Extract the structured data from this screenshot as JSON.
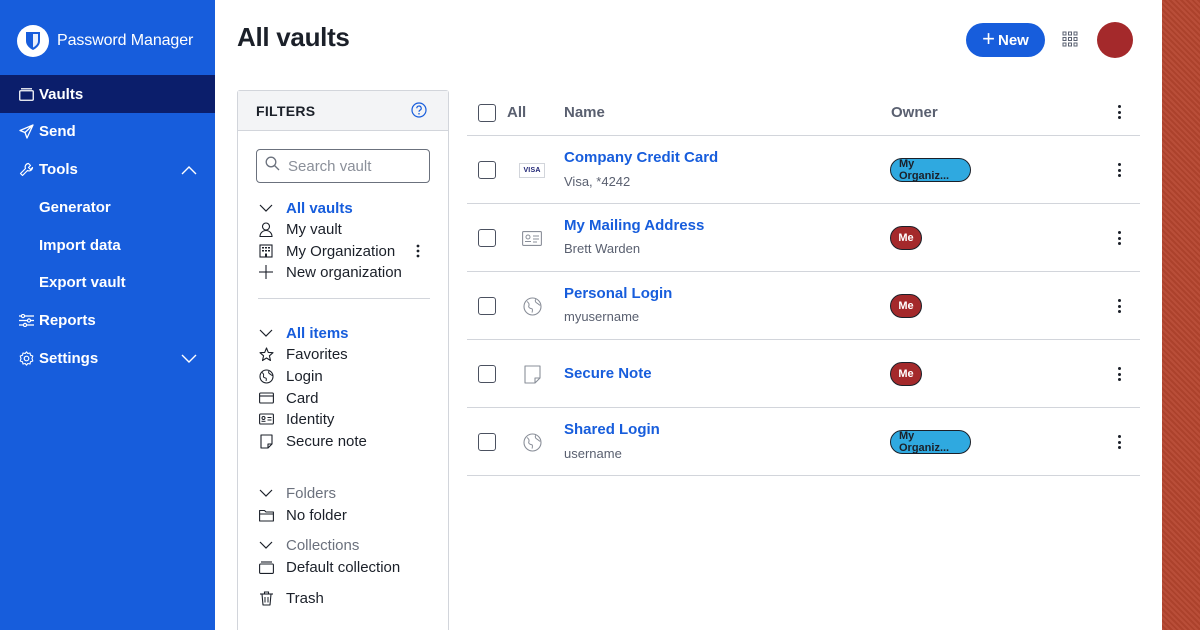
{
  "brand": {
    "name": "Password Manager"
  },
  "sidebar": {
    "items": [
      {
        "label": "Vaults",
        "icon": "vault-icon",
        "active": true
      },
      {
        "label": "Send",
        "icon": "send-icon"
      },
      {
        "label": "Tools",
        "icon": "tools-icon",
        "expanded": true
      },
      {
        "label": "Generator",
        "sub": true
      },
      {
        "label": "Import data",
        "sub": true
      },
      {
        "label": "Export vault",
        "sub": true
      },
      {
        "label": "Reports",
        "icon": "reports-icon"
      },
      {
        "label": "Settings",
        "icon": "settings-icon",
        "expanded": false
      }
    ]
  },
  "header": {
    "title": "All vaults",
    "new_label": "New"
  },
  "filters": {
    "title": "FILTERS",
    "search_placeholder": "Search vault",
    "vaults": {
      "heading": "All vaults",
      "items": [
        "My vault",
        "My Organization",
        "New organization"
      ]
    },
    "types": {
      "heading": "All items",
      "items": [
        "Favorites",
        "Login",
        "Card",
        "Identity",
        "Secure note"
      ]
    },
    "folders": {
      "heading": "Folders",
      "items": [
        "No folder"
      ]
    },
    "collections": {
      "heading": "Collections",
      "items": [
        "Default collection"
      ]
    },
    "trash": "Trash"
  },
  "table": {
    "columns": {
      "all": "All",
      "name": "Name",
      "owner": "Owner"
    },
    "rows": [
      {
        "name": "Company Credit Card",
        "sub": "Visa, *4242",
        "type": "card",
        "icon_label": "VISA",
        "owner": "My Organiz...",
        "owner_type": "org"
      },
      {
        "name": "My Mailing Address",
        "sub": "Brett Warden",
        "type": "identity",
        "owner": "Me",
        "owner_type": "me"
      },
      {
        "name": "Personal Login",
        "sub": "myusername",
        "type": "login",
        "owner": "Me",
        "owner_type": "me"
      },
      {
        "name": "Secure Note",
        "sub": "",
        "type": "note",
        "owner": "Me",
        "owner_type": "me"
      },
      {
        "name": "Shared Login",
        "sub": "username",
        "type": "login",
        "owner": "My Organiz...",
        "owner_type": "org"
      }
    ]
  },
  "colors": {
    "primary": "#175ddc",
    "sidebar_active": "#0b1e6b",
    "avatar": "#a4292b",
    "org_badge": "#2fa9e0",
    "me_badge": "#a4292b"
  }
}
